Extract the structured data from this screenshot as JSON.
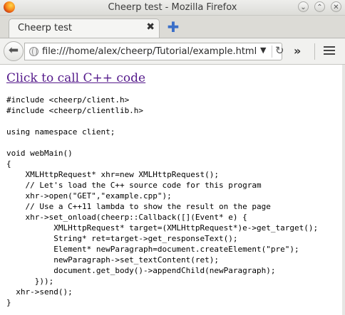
{
  "window": {
    "title": "Cheerp test - Mozilla Firefox",
    "minimize_glyph": "⌄",
    "maximize_glyph": "⌃",
    "close_glyph": "✕"
  },
  "tabs": [
    {
      "label": "Cheerp test",
      "close_glyph": "✖"
    }
  ],
  "new_tab_glyph": "✚",
  "navbar": {
    "back_glyph": "⬅",
    "url": "file:///home/alex/cheerp/Tutorial/example.html",
    "dropdown_glyph": "▼",
    "reload_glyph": "↻",
    "overflow_glyph": "»"
  },
  "page": {
    "link_text": "Click to call C++ code",
    "code_lines": [
      "#include <cheerp/client.h>",
      "#include <cheerp/clientlib.h>",
      "",
      "using namespace client;",
      "",
      "void webMain()",
      "{",
      "    XMLHttpRequest* xhr=new XMLHttpRequest();",
      "    // Let's load the C++ source code for this program",
      "    xhr->open(\"GET\",\"example.cpp\");",
      "    // Use a C++11 lambda to show the result on the page",
      "    xhr->set_onload(cheerp::Callback([](Event* e) {",
      "          XMLHttpRequest* target=(XMLHttpRequest*)e->get_target();",
      "          String* ret=target->get_responseText();",
      "          Element* newParagraph=document.createElement(\"pre\");",
      "          newParagraph->set_textContent(ret);",
      "          document.get_body()->appendChild(newParagraph);",
      "      }));",
      "  xhr->send();",
      "}"
    ]
  }
}
